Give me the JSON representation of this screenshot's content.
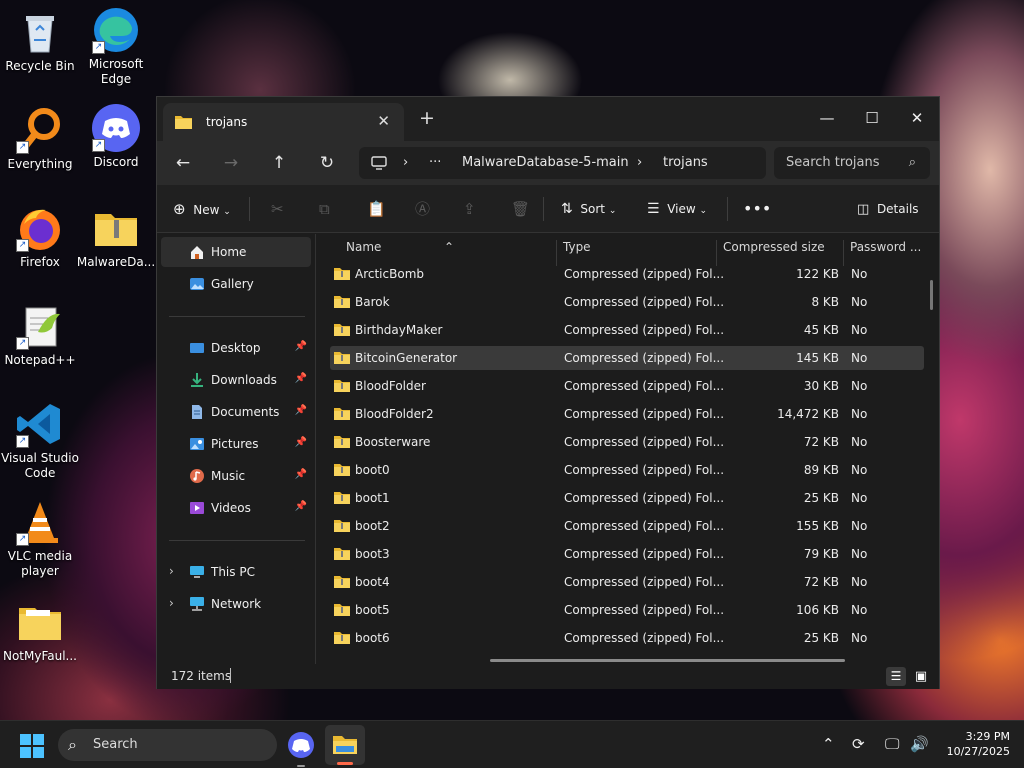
{
  "desktop": {
    "icons": [
      {
        "label": "Recycle Bin"
      },
      {
        "label": "Microsoft Edge"
      },
      {
        "label": "Everything"
      },
      {
        "label": "Discord"
      },
      {
        "label": "Firefox"
      },
      {
        "label": "MalwareDa..."
      },
      {
        "label": "Notepad++"
      },
      {
        "label": "Visual Studio Code"
      },
      {
        "label": "VLC media player"
      },
      {
        "label": "NotMyFaul..."
      }
    ]
  },
  "window": {
    "tab_title": "trojans",
    "breadcrumb": [
      "MalwareDatabase-5-main",
      "trojans"
    ],
    "search_placeholder": "Search trojans",
    "toolbar": {
      "new_label": "New",
      "sort_label": "Sort",
      "view_label": "View",
      "details_label": "Details"
    },
    "nav": {
      "home": "Home",
      "gallery": "Gallery",
      "quick": [
        {
          "label": "Desktop"
        },
        {
          "label": "Downloads"
        },
        {
          "label": "Documents"
        },
        {
          "label": "Pictures"
        },
        {
          "label": "Music"
        },
        {
          "label": "Videos"
        }
      ],
      "this_pc": "This PC",
      "network": "Network"
    },
    "columns": {
      "name": "Name",
      "type": "Type",
      "size": "Compressed size",
      "password": "Password ..."
    },
    "files": [
      {
        "name": "ArcticBomb",
        "type": "Compressed (zipped) Fol...",
        "size": "122 KB",
        "pw": "No"
      },
      {
        "name": "Barok",
        "type": "Compressed (zipped) Fol...",
        "size": "8 KB",
        "pw": "No"
      },
      {
        "name": "BirthdayMaker",
        "type": "Compressed (zipped) Fol...",
        "size": "45 KB",
        "pw": "No"
      },
      {
        "name": "BitcoinGenerator",
        "type": "Compressed (zipped) Fol...",
        "size": "145 KB",
        "pw": "No"
      },
      {
        "name": "BloodFolder",
        "type": "Compressed (zipped) Fol...",
        "size": "30 KB",
        "pw": "No"
      },
      {
        "name": "BloodFolder2",
        "type": "Compressed (zipped) Fol...",
        "size": "14,472 KB",
        "pw": "No"
      },
      {
        "name": "Boosterware",
        "type": "Compressed (zipped) Fol...",
        "size": "72 KB",
        "pw": "No"
      },
      {
        "name": "boot0",
        "type": "Compressed (zipped) Fol...",
        "size": "89 KB",
        "pw": "No"
      },
      {
        "name": "boot1",
        "type": "Compressed (zipped) Fol...",
        "size": "25 KB",
        "pw": "No"
      },
      {
        "name": "boot2",
        "type": "Compressed (zipped) Fol...",
        "size": "155 KB",
        "pw": "No"
      },
      {
        "name": "boot3",
        "type": "Compressed (zipped) Fol...",
        "size": "79 KB",
        "pw": "No"
      },
      {
        "name": "boot4",
        "type": "Compressed (zipped) Fol...",
        "size": "72 KB",
        "pw": "No"
      },
      {
        "name": "boot5",
        "type": "Compressed (zipped) Fol...",
        "size": "106 KB",
        "pw": "No"
      },
      {
        "name": "boot6",
        "type": "Compressed (zipped) Fol...",
        "size": "25 KB",
        "pw": "No"
      }
    ],
    "status": {
      "item_count": "172 items"
    }
  },
  "taskbar": {
    "search_label": "Search",
    "time": "3:29 PM",
    "date": "10/27/2025"
  }
}
